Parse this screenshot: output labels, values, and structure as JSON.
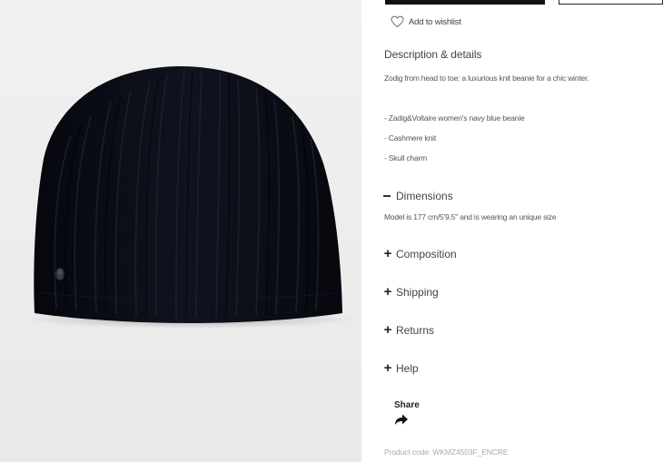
{
  "wishlist": {
    "label": "Add to wishlist"
  },
  "description": {
    "title": "Description & details",
    "intro": "Zodig from head to toe: a luxurious knit beanie for a chic winter.",
    "bullets": [
      "- Zadig&Voltaire women's navy blue beanie",
      "- Cashmere knit",
      "- Skull charm"
    ]
  },
  "dimensions": {
    "label": "Dimensions",
    "text": "Model is 177 cm/5'9.5\" and is wearing an unique size"
  },
  "accordions": [
    {
      "label": "Composition"
    },
    {
      "label": "Shipping"
    },
    {
      "label": "Returns"
    },
    {
      "label": "Help"
    }
  ],
  "share": {
    "label": "Share"
  },
  "product_code": "Product code: WKMZ4503F_ENCRE",
  "colors": {
    "beanie": "#0c0f1c",
    "panel_bg": "#eeeeee",
    "text": "#444444"
  }
}
